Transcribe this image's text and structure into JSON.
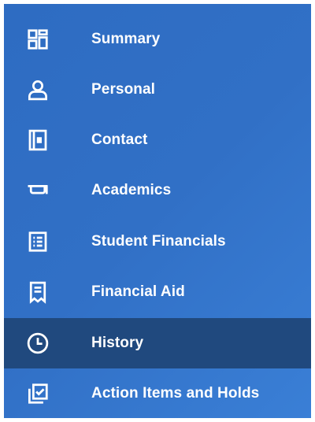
{
  "sidebar": {
    "items": [
      {
        "label": "Summary",
        "icon": "dashboard-grid-icon",
        "active": false
      },
      {
        "label": "Personal",
        "icon": "person-icon",
        "active": false
      },
      {
        "label": "Contact",
        "icon": "contact-book-icon",
        "active": false
      },
      {
        "label": "Academics",
        "icon": "graduation-cap-icon",
        "active": false
      },
      {
        "label": "Student Financials",
        "icon": "financial-document-icon",
        "active": false
      },
      {
        "label": "Financial Aid",
        "icon": "receipt-icon",
        "active": false
      },
      {
        "label": "History",
        "icon": "clock-icon",
        "active": true
      },
      {
        "label": "Action Items and Holds",
        "icon": "checklist-stack-icon",
        "active": false
      }
    ]
  },
  "colors": {
    "sidebar_background": "#3170c6",
    "active_background": "#20497e",
    "text": "#ffffff"
  }
}
